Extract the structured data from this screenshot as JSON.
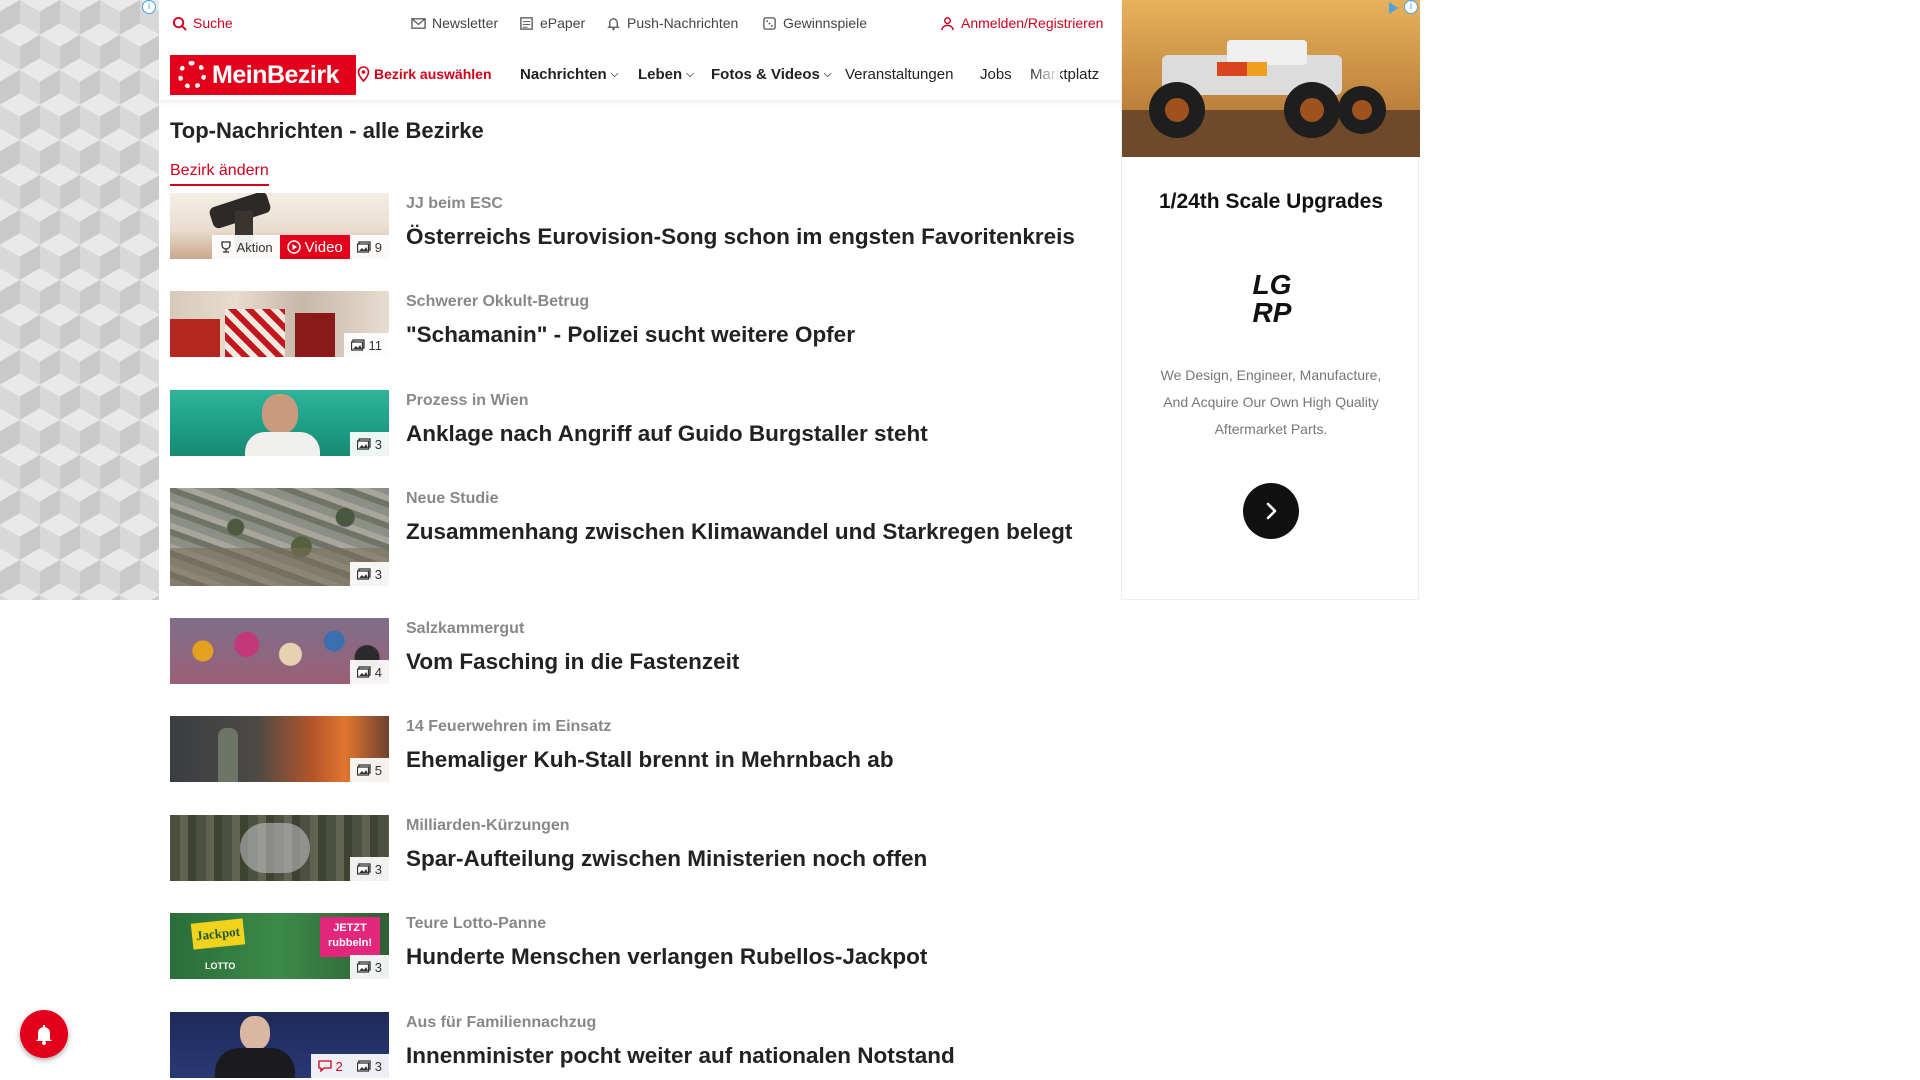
{
  "utility_bar": {
    "search": "Suche",
    "newsletter": "Newsletter",
    "epaper": "ePaper",
    "push": "Push-Nachrichten",
    "games": "Gewinnspiele",
    "login": "Anmelden/Registrieren"
  },
  "nav": {
    "logo": "MeinBezirk",
    "district": "Bezirk auswählen",
    "items": [
      "Nachrichten",
      "Leben",
      "Fotos & Videos",
      "Veranstaltungen",
      "Jobs",
      "Marktplatz"
    ]
  },
  "main": {
    "title": "Top-Nachrichten - alle Bezirke",
    "change_link": "Bezirk ändern",
    "articles": [
      {
        "kicker": "JJ beim ESC",
        "headline": "Österreichs Eurovision-Song schon im engsten Favoritenkreis",
        "badge_action": "Aktion",
        "badge_video": "Video",
        "images": "9"
      },
      {
        "kicker": "Schwerer Okkult-Betrug",
        "headline": "\"Schamanin\" - Polizei sucht weitere Opfer",
        "images": "11"
      },
      {
        "kicker": "Prozess in Wien",
        "headline": "Anklage nach Angriff auf Guido Burgstaller steht",
        "images": "3"
      },
      {
        "kicker": "Neue Studie",
        "headline": "Zusammenhang zwischen Klimawandel und Starkregen belegt",
        "images": "3"
      },
      {
        "kicker": "Salzkammergut",
        "headline": "Vom Fasching in die Fastenzeit",
        "images": "4"
      },
      {
        "kicker": "14 Feuerwehren im Einsatz",
        "headline": "Ehemaliger Kuh-Stall brennt in Mehrnbach ab",
        "images": "5"
      },
      {
        "kicker": "Milliarden-Kürzungen",
        "headline": "Spar-Aufteilung zwischen Ministerien noch offen",
        "images": "3"
      },
      {
        "kicker": "Teure Lotto-Panne",
        "headline": "Hunderte Menschen verlangen Rubellos-Jackpot",
        "images": "3",
        "image_text_1": "Jackpot",
        "image_text_2": "JETZT rubbeln!",
        "image_text_3": "LOTTO"
      },
      {
        "kicker": "Aus für Familiennachzug",
        "headline": "Innenminister pocht weiter auf nationalen Notstand",
        "comments": "2",
        "images": "3"
      }
    ]
  },
  "ad": {
    "title": "1/24th Scale Upgrades",
    "brand": "LGRP",
    "description": "We Design, Engineer, Manufacture, And Acquire Our Own High Quality Aftermarket Parts."
  },
  "colors": {
    "brand_red": "#e2001a",
    "link_red": "#d0021b"
  }
}
